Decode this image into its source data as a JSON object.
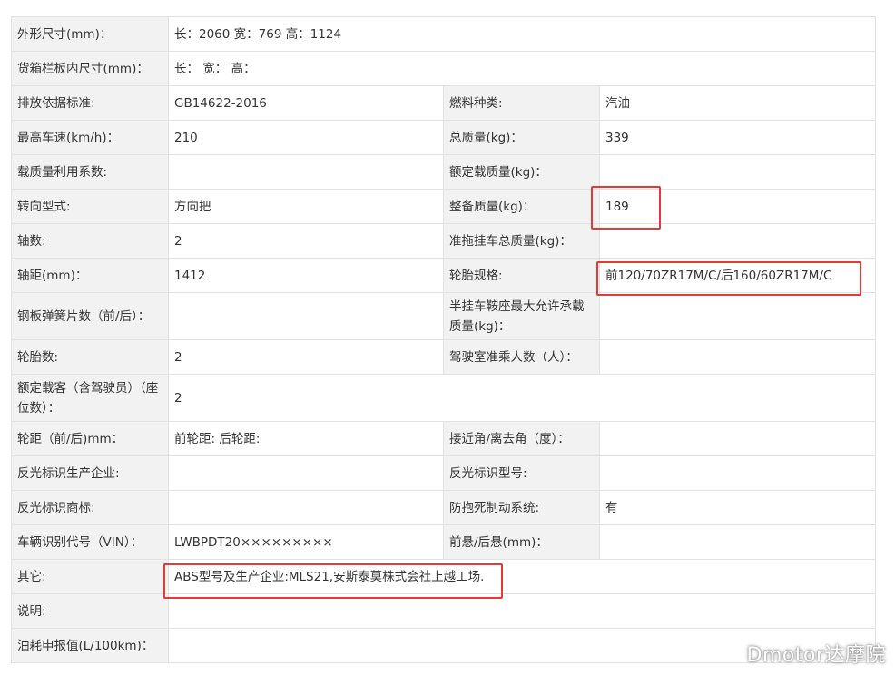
{
  "rows": [
    {
      "l1": "外形尺寸(mm)：",
      "v1": "长：2060 宽：769 高：1124"
    },
    {
      "l1": "货箱栏板内尺寸(mm)：",
      "v1": "长： 宽： 高："
    },
    {
      "l1": "排放依据标准:",
      "v1": "GB14622-2016",
      "l2": "燃料种类:",
      "v2": "汽油"
    },
    {
      "l1": "最高车速(km/h)：",
      "v1": "210",
      "l2": "总质量(kg)：",
      "v2": "339"
    },
    {
      "l1": "载质量利用系数:",
      "v1": "",
      "l2": "额定载质量(kg)：",
      "v2": ""
    },
    {
      "l1": "转向型式:",
      "v1": "方向把",
      "l2": "整备质量(kg)：",
      "v2": "189"
    },
    {
      "l1": "轴数:",
      "v1": "2",
      "l2": "准拖挂车总质量(kg)：",
      "v2": ""
    },
    {
      "l1": "轴距(mm)：",
      "v1": "1412",
      "l2": "轮胎规格:",
      "v2": "前120/70ZR17M/C/后160/60ZR17M/C"
    },
    {
      "l1": "钢板弹簧片数（前/后）：",
      "v1": "",
      "l2": "半挂车鞍座最大允许承载质量(kg)：",
      "v2": ""
    },
    {
      "l1": "轮胎数:",
      "v1": "2",
      "l2": "驾驶室准乘人数（人）：",
      "v2": ""
    },
    {
      "l1": "额定载客（含驾驶员）（座位数）：",
      "v1": "2"
    },
    {
      "l1": "轮距（前/后)mm：",
      "v1": "前轮距: 后轮距:",
      "l2": "接近角/离去角（度）：",
      "v2": ""
    },
    {
      "l1": "反光标识生产企业:",
      "v1": "",
      "l2": "反光标识型号:",
      "v2": ""
    },
    {
      "l1": "反光标识商标:",
      "v1": "",
      "l2": "防抱死制动系统:",
      "v2": "有"
    },
    {
      "l1": "车辆识别代号（VIN）：",
      "v1": "LWBPDT20×××××××××",
      "l2": "前悬/后悬(mm)：",
      "v2": ""
    },
    {
      "l1": "其它:",
      "v1": "ABS型号及生产企业:MLS21,安斯泰莫株式会社上越工场."
    },
    {
      "l1": "说明:",
      "v1": ""
    },
    {
      "l1": "油耗申报值(L/100km)：",
      "v1": ""
    }
  ],
  "watermark": "Dmotor达摩院",
  "highlight_color": "#e53935"
}
